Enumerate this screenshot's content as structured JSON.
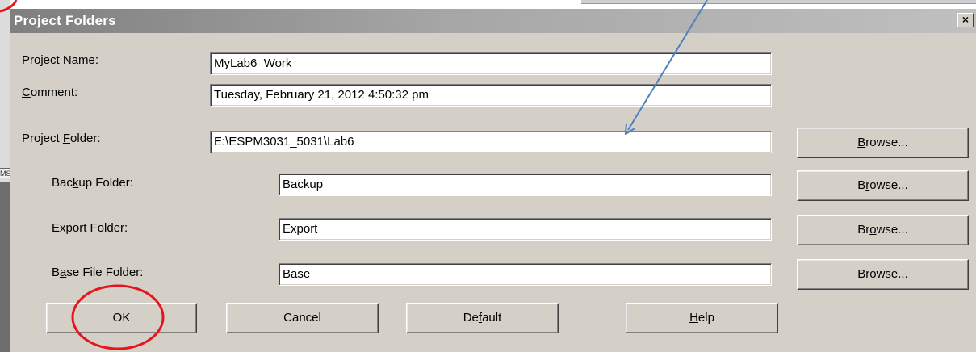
{
  "dialog": {
    "title": "Project Folders",
    "close_glyph": "×"
  },
  "background": {
    "fragment_text": "MS"
  },
  "fields": {
    "project_name": {
      "label_pre": "",
      "label_key": "P",
      "label_post": "roject Name:",
      "value": "MyLab6_Work"
    },
    "comment": {
      "label_pre": "",
      "label_key": "C",
      "label_post": "omment:",
      "value": "Tuesday, February 21, 2012 4:50:32 pm"
    },
    "project_folder": {
      "label_pre": "Project ",
      "label_key": "F",
      "label_post": "older:",
      "value": "E:\\ESPM3031_5031\\Lab6"
    },
    "backup_folder": {
      "label_pre": "Bac",
      "label_key": "k",
      "label_post": "up Folder:",
      "value": "Backup"
    },
    "export_folder": {
      "label_pre": "",
      "label_key": "E",
      "label_post": "xport Folder:",
      "value": "Export"
    },
    "base_folder": {
      "label_pre": "B",
      "label_key": "a",
      "label_post": "se File Folder:",
      "value": "Base"
    }
  },
  "browse_buttons": [
    {
      "pre": "",
      "key": "B",
      "post": "rowse..."
    },
    {
      "pre": "B",
      "key": "r",
      "post": "owse..."
    },
    {
      "pre": "Br",
      "key": "o",
      "post": "wse..."
    },
    {
      "pre": "Bro",
      "key": "w",
      "post": "se..."
    }
  ],
  "buttons": {
    "ok": {
      "pre": "OK",
      "key": "",
      "post": ""
    },
    "cancel": {
      "pre": "Cancel",
      "key": "",
      "post": ""
    },
    "default": {
      "pre": "De",
      "key": "f",
      "post": "ault"
    },
    "help": {
      "pre": "",
      "key": "H",
      "post": "elp"
    }
  },
  "colors": {
    "dialog_bg": "#d4d0c8",
    "annotation_red": "#e8141b",
    "annotation_arrow_blue": "#4f81bd"
  }
}
